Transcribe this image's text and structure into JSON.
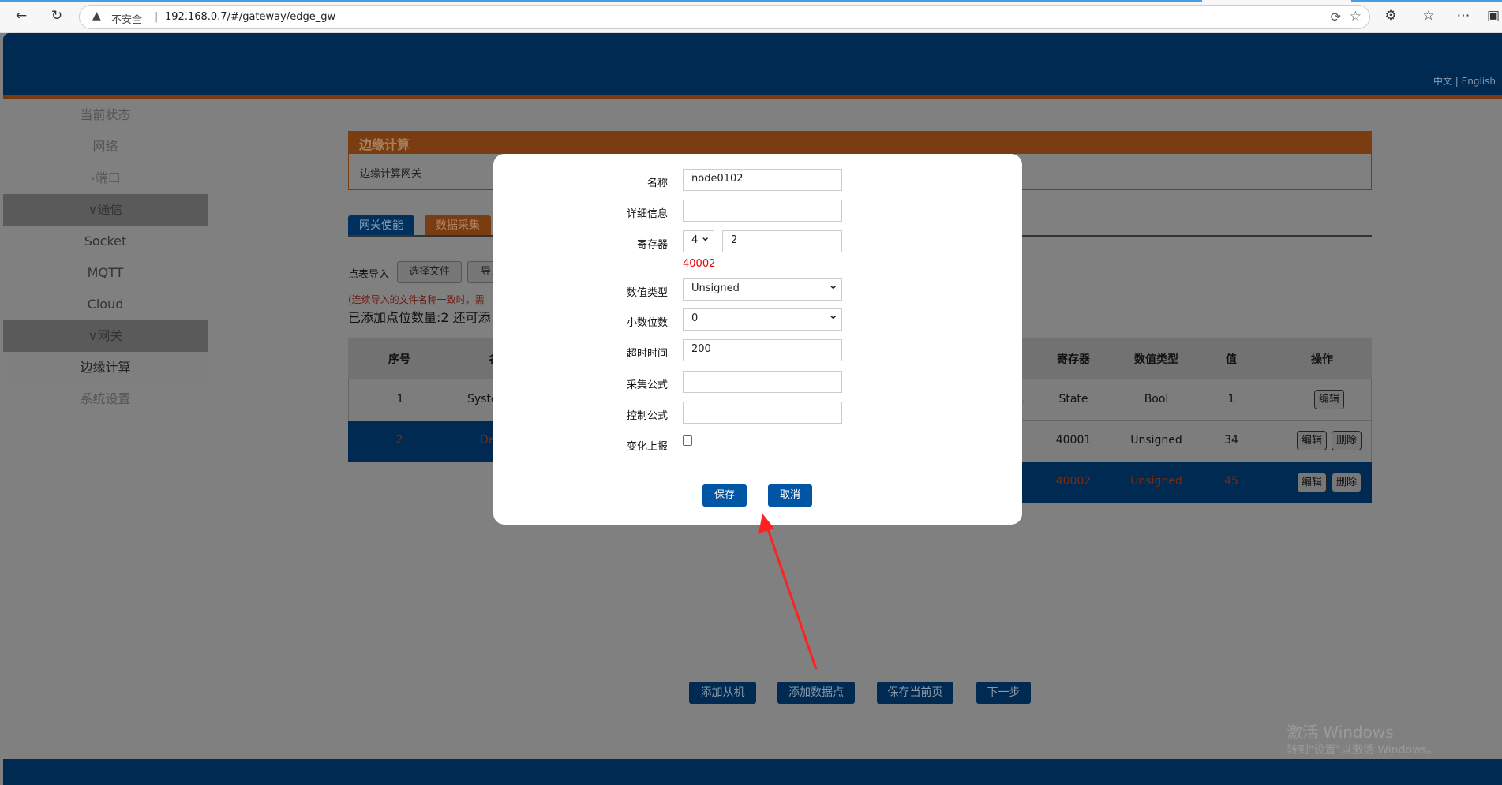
{
  "browser": {
    "back_icon": "arrow-left",
    "reload_icon": "reload",
    "security_label": "不安全",
    "url": "192.168.0.7/#/gateway/edge_gw"
  },
  "header": {
    "language": "中文 | English"
  },
  "sidebar": {
    "items": [
      {
        "label": "当前状态"
      },
      {
        "label": "网络"
      },
      {
        "label": "›端口"
      },
      {
        "label": "∨通信"
      },
      {
        "label": "Socket"
      },
      {
        "label": "MQTT"
      },
      {
        "label": "Cloud"
      },
      {
        "label": "∨网关"
      },
      {
        "label": "边缘计算"
      },
      {
        "label": "系统设置"
      }
    ]
  },
  "panel": {
    "title": "边缘计算",
    "subtitle": "边缘计算网关"
  },
  "tabs": [
    {
      "label": "网关使能"
    },
    {
      "label": "数据采集"
    }
  ],
  "import": {
    "label": "点表导入",
    "choose_file": "选择文件",
    "import_btn": "导入"
  },
  "note": "(连续导入的文件名称一致时，需",
  "count_text": "已添加点位数量:2  还可添",
  "table": {
    "headers": {
      "index": "序号",
      "name": "名",
      "register": "寄存器",
      "type": "数值类型",
      "value": "值",
      "action": "操作"
    },
    "left_rows": [
      {
        "index": "1",
        "name": "Syste"
      },
      {
        "index": "2",
        "name": "De"
      }
    ],
    "right_rows": [
      {
        "register": "State",
        "type": "Bool",
        "value": "1",
        "edit": "编辑"
      },
      {
        "register": "40001",
        "type": "Unsigned",
        "value": "34",
        "edit": "编辑",
        "delete": "删除"
      },
      {
        "register": "40002",
        "type": "Unsigned",
        "value": "45",
        "edit": "编辑",
        "delete": "删除"
      }
    ],
    "ellipsis": ".."
  },
  "dialog": {
    "name_label": "名称",
    "name_value": "node0102",
    "detail_label": "详细信息",
    "detail_value": "",
    "register_label": "寄存器",
    "register_type": "4",
    "register_value": "2",
    "register_code": "40002",
    "datatype_label": "数值类型",
    "datatype_value": "Unsigned",
    "decimal_label": "小数位数",
    "decimal_value": "0",
    "timeout_label": "超时时间",
    "timeout_value": "200",
    "collect_formula_label": "采集公式",
    "collect_formula_value": "",
    "control_formula_label": "控制公式",
    "control_formula_value": "",
    "change_report_label": "变化上报",
    "change_report_checked": false,
    "save": "保存",
    "cancel": "取消"
  },
  "bottom_buttons": {
    "add_slave": "添加从机",
    "add_point": "添加数据点",
    "save_page": "保存当前页",
    "next": "下一步"
  },
  "watermark": {
    "line1": "激活 Windows",
    "line2": "转到\"设置\"以激活 Windows。"
  },
  "annotation": {
    "arrow_color": "#ff2020"
  }
}
